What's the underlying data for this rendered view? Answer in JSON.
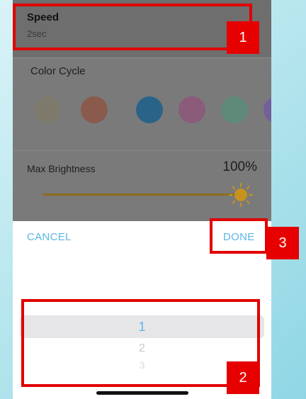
{
  "settings": {
    "speed": {
      "title": "Speed",
      "value": "2sec"
    },
    "color_cycle": {
      "title": "Color Cycle",
      "swatches": [
        "#7d7a6c",
        "#8a5b4c",
        "#2a6388",
        "#8a5c7a",
        "#5f8a7a",
        "#73609a"
      ]
    },
    "max_brightness": {
      "title": "Max Brightness",
      "value": "100%",
      "level_percent": 100
    }
  },
  "sheet": {
    "cancel_label": "CANCEL",
    "done_label": "DONE",
    "picker": {
      "items": [
        "1",
        "2",
        "3"
      ],
      "selected": "1"
    }
  },
  "annotations": {
    "badge1": "1",
    "badge2": "2",
    "badge3": "3"
  },
  "colors": {
    "accent": "#5ab7e6",
    "annotation_red": "#e60000",
    "slider": "#c8921e"
  }
}
